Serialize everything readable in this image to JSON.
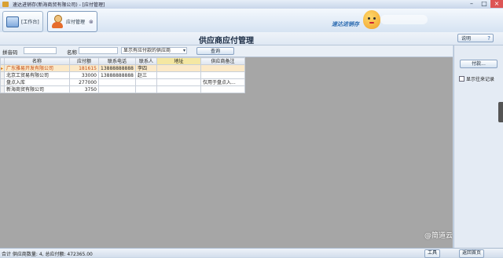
{
  "window": {
    "title": "速达进销存(新海商贸有限公司) - [应付管理]"
  },
  "toolbar": {
    "tabs": [
      {
        "label": "[工作台]",
        "icon": "desktop-icon"
      },
      {
        "label": "应付管理",
        "icon": "person-icon"
      }
    ],
    "brand_text": "速达进销存"
  },
  "page": {
    "title": "供应商应付管理",
    "help_label": "说明"
  },
  "filters": {
    "code_label": "拼音码",
    "name_label": "名称",
    "scope_value": "显示有应付款的供应商",
    "query_label": "查询"
  },
  "grid": {
    "columns": [
      "名称",
      "应付额",
      "联系电话",
      "联系人",
      "地址",
      "供应商备注"
    ],
    "rows": [
      {
        "name": "广东雅易开发有限公司",
        "amount": "181615",
        "phone": "13888888888",
        "contact": "李四",
        "address": "",
        "note": ""
      },
      {
        "name": "北京工贸易有限公司",
        "amount": "33000",
        "phone": "13888888888",
        "contact": "赵三",
        "address": "",
        "note": ""
      },
      {
        "name": "盘点入库",
        "amount": "277000",
        "phone": "",
        "contact": "",
        "address": "",
        "note": "仅用于盘点入..."
      },
      {
        "name": "新海商贸有限公司",
        "amount": "3750",
        "phone": "",
        "contact": "",
        "address": "",
        "note": ""
      }
    ]
  },
  "side": {
    "pay_button": "付款...",
    "show_history": "显示往来记录"
  },
  "status": {
    "summary": "合计 供应商数量: 4, 总应付额: 472365.00",
    "tools_label": "工具",
    "back_label": "返回首页"
  },
  "watermark": "@简道云"
}
